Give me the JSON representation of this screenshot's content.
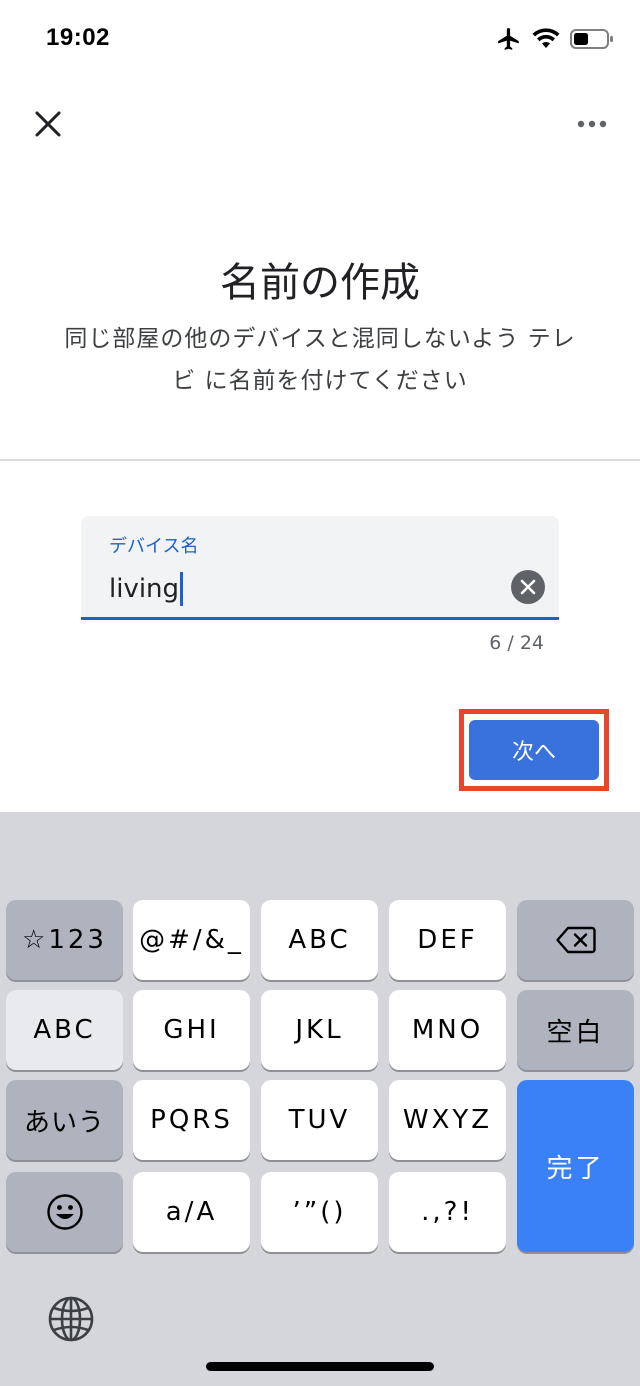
{
  "status": {
    "time": "19:02",
    "icons": [
      "airplane-icon",
      "wifi-icon",
      "battery-icon"
    ]
  },
  "header": {
    "close_icon": "close-icon",
    "more_icon": "more-horizontal-icon"
  },
  "content": {
    "title": "名前の作成",
    "subtitle_line1": "同じ部屋の他のデバイスと混同しないよう テレ",
    "subtitle_line2": "ビ に名前を付けてください"
  },
  "field": {
    "label": "デバイス名",
    "value": "living",
    "counter": "6 / 24"
  },
  "next_button": {
    "label": "次へ"
  },
  "keyboard": {
    "row1": [
      "☆123",
      "@#/&_",
      "ABC",
      "DEF"
    ],
    "row2": [
      "ABC",
      "GHI",
      "JKL",
      "MNO",
      "空白"
    ],
    "row3": [
      "あいう",
      "PQRS",
      "TUV",
      "WXYZ"
    ],
    "row4": [
      "a/A",
      "’”()",
      ".,?!"
    ],
    "done": "完了",
    "emoji_icon": "emoji-icon",
    "backspace_icon": "backspace-icon",
    "globe_icon": "globe-icon"
  },
  "colors": {
    "accent": "#1a63c9",
    "button": "#3a72dc",
    "highlight": "#e8452c",
    "done_key": "#3a80f6"
  }
}
